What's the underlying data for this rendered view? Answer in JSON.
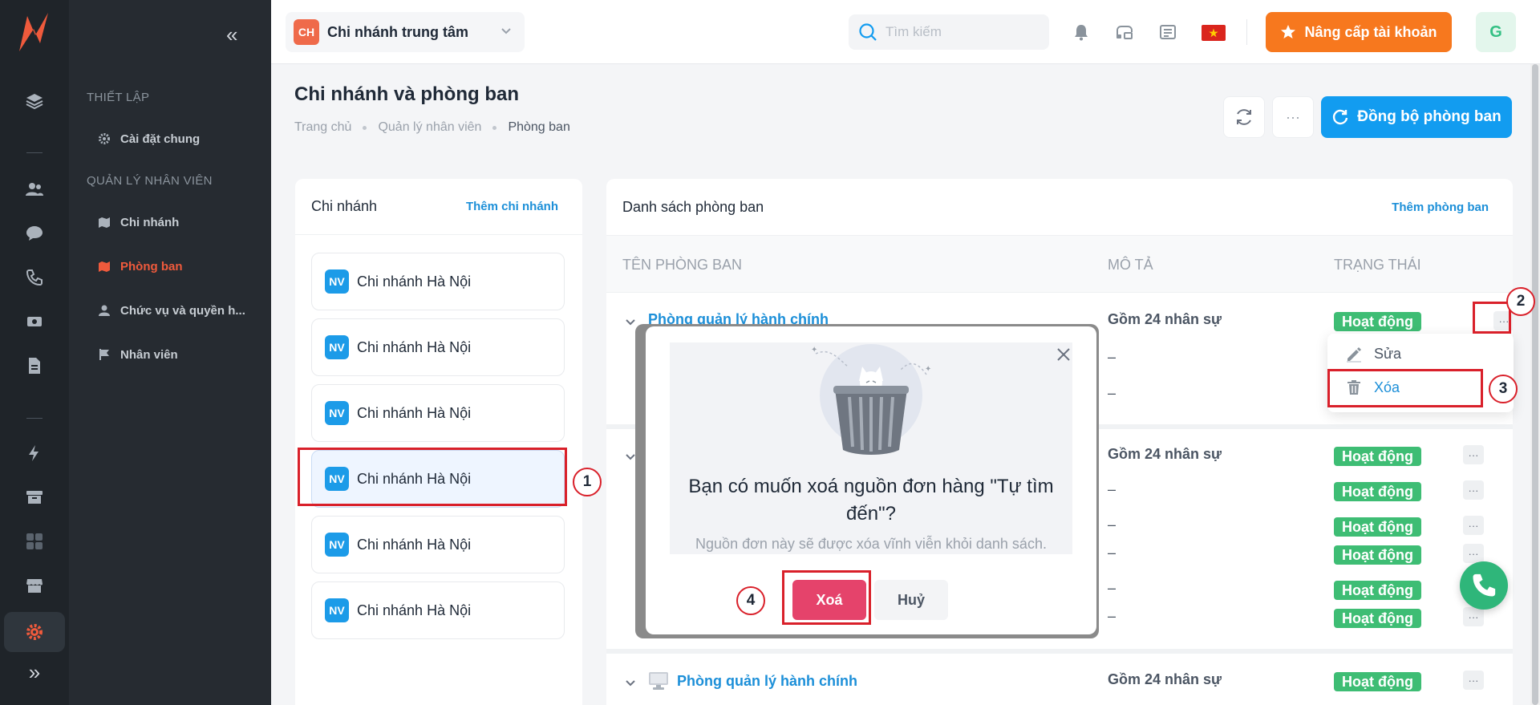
{
  "branch_selector": {
    "code": "CH",
    "name": "Chi nhánh trung tâm"
  },
  "search": {
    "placeholder": "Tìm kiếm"
  },
  "upgrade_label": "Nâng cấp tài khoản",
  "avatar_initial": "G",
  "sidebar": {
    "section_setup": "THIẾT LẬP",
    "general_settings": "Cài đặt chung",
    "section_staff": "QUẢN LÝ NHÂN VIÊN",
    "items": [
      {
        "label": "Chi nhánh",
        "icon": "map-icon"
      },
      {
        "label": "Phòng ban",
        "icon": "map-icon",
        "active": true
      },
      {
        "label": "Chức vụ và quyền h...",
        "icon": "user-icon"
      },
      {
        "label": "Nhân viên",
        "icon": "flag-icon"
      }
    ]
  },
  "page": {
    "title": "Chi nhánh và phòng ban",
    "breadcrumb": [
      "Trang chủ",
      "Quản lý nhân viên",
      "Phòng ban"
    ],
    "more_label": "···",
    "sync_label": "Đồng bộ phòng ban"
  },
  "branches": {
    "title": "Chi nhánh",
    "add_label": "Thêm chi nhánh",
    "items": [
      {
        "code": "NV",
        "name": "Chi nhánh Hà Nội"
      },
      {
        "code": "NV",
        "name": "Chi nhánh Hà Nội"
      },
      {
        "code": "NV",
        "name": "Chi nhánh Hà Nội"
      },
      {
        "code": "NV",
        "name": "Chi nhánh Hà Nội",
        "selected": true
      },
      {
        "code": "NV",
        "name": "Chi nhánh Hà Nội"
      },
      {
        "code": "NV",
        "name": "Chi nhánh Hà Nội"
      }
    ]
  },
  "departments": {
    "title": "Danh sách phòng ban",
    "add_label": "Thêm phòng ban",
    "columns": [
      "TÊN PHÒNG BAN",
      "MÔ TẢ",
      "TRẠNG THÁI"
    ],
    "group_name": "Phòng quản lý hành chính",
    "group_desc": "Gồm 24 nhân sự",
    "dash": "–",
    "status": "Hoạt động",
    "more": "···"
  },
  "menu": {
    "edit": "Sửa",
    "delete": "Xóa"
  },
  "dialog": {
    "question": "Bạn có muốn xoá nguồn đơn hàng \"Tự tìm đến\"?",
    "subtitle": "Nguồn đơn này sẽ được xóa vĩnh viễn khỏi danh sách.",
    "confirm": "Xoá",
    "cancel": "Huỷ"
  },
  "annotations": [
    "1",
    "2",
    "3",
    "4"
  ],
  "colors": {
    "accent": "#ef5a3c",
    "primary": "#129cf0",
    "success": "#3ebd74",
    "danger": "#e5436b",
    "highlight": "#d9202a",
    "upgrade": "#f7781e"
  }
}
